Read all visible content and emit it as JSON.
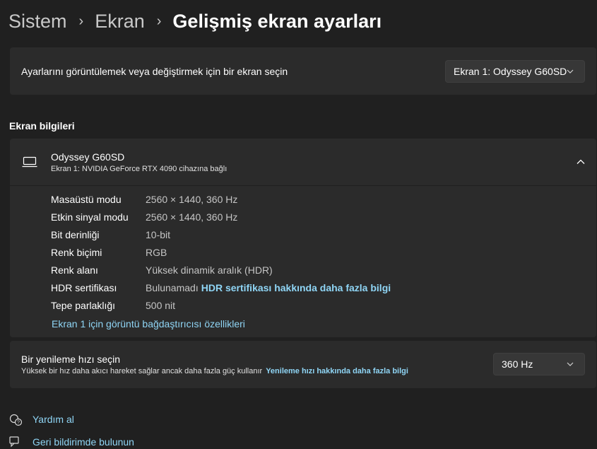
{
  "breadcrumb": {
    "level1": "Sistem",
    "level2": "Ekran",
    "current": "Gelişmiş ekran ayarları",
    "separator": "›"
  },
  "display_select": {
    "label": "Ayarlarını görüntülemek veya değiştirmek için bir ekran seçin",
    "selected": "Ekran 1: Odyssey G60SD"
  },
  "display_info": {
    "section_title": "Ekran bilgileri",
    "device_name": "Odyssey G60SD",
    "device_subtitle": "Ekran 1: NVIDIA GeForce RTX 4090 cihazına bağlı",
    "properties": [
      {
        "label": "Masaüstü modu",
        "value": "2560 × 1440, 360 Hz"
      },
      {
        "label": "Etkin sinyal modu",
        "value": "2560 × 1440, 360 Hz"
      },
      {
        "label": "Bit derinliği",
        "value": "10-bit"
      },
      {
        "label": "Renk biçimi",
        "value": "RGB"
      },
      {
        "label": "Renk alanı",
        "value": "Yüksek dinamik aralık (HDR)"
      },
      {
        "label": "HDR sertifikası",
        "value": "Bulunamadı",
        "link": "HDR sertifikası hakkında daha fazla bilgi"
      },
      {
        "label": "Tepe parlaklığı",
        "value": "500 nit"
      }
    ],
    "adapter_link": "Ekran 1 için görüntü bağdaştırıcısı özellikleri"
  },
  "refresh": {
    "title": "Bir yenileme hızı seçin",
    "subtitle": "Yüksek bir hız daha akıcı hareket sağlar ancak daha fazla güç kullanır",
    "link": "Yenileme hızı hakkında daha fazla bilgi",
    "selected": "360 Hz"
  },
  "footer": {
    "help": "Yardım al",
    "feedback": "Geri bildirimde bulunun"
  },
  "colors": {
    "background": "#202020",
    "card": "#2b2b2b",
    "link": "#8fd5f5"
  }
}
